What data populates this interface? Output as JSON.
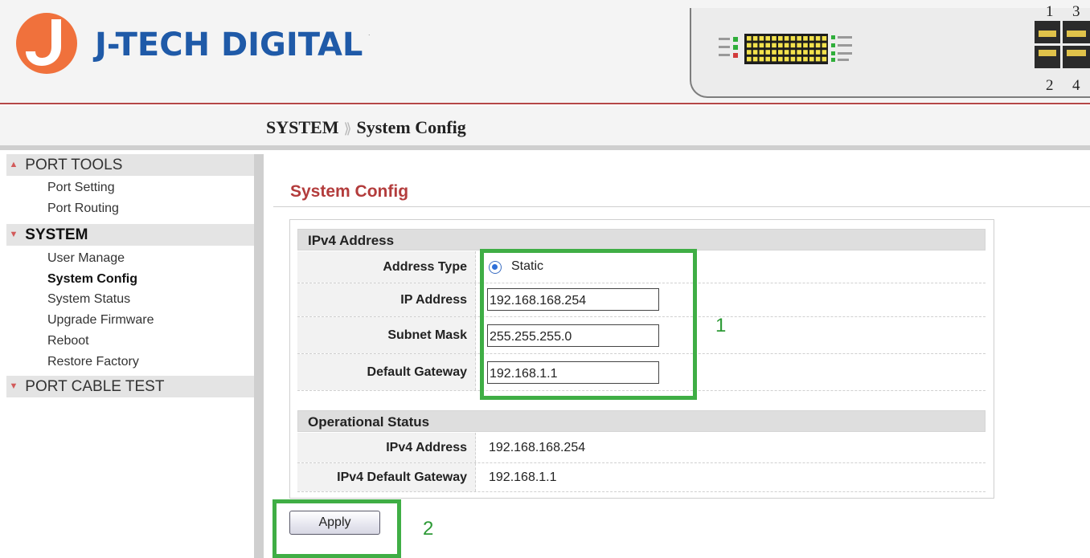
{
  "colors": {
    "brand_blue": "#1f5aa8",
    "brand_orange": "#f0713c",
    "accent_red": "#b33c3c",
    "annotation_green": "#3fae45",
    "radio_blue": "#2e6fd8"
  },
  "header": {
    "logo_text": "J-TECH DIGITAL",
    "logo_tm": ".",
    "port_numbers_top": [
      "1",
      "3"
    ],
    "port_numbers_bottom": [
      "2",
      "4"
    ]
  },
  "breadcrumb": {
    "section": "SYSTEM",
    "separator": "⟫",
    "page": "System Config"
  },
  "sidebar": {
    "groups": [
      {
        "label": "PORT TOOLS",
        "items": [
          "Port Setting",
          "Port Routing"
        ]
      },
      {
        "label": "SYSTEM",
        "items": [
          "User Manage",
          "System Config",
          "System Status",
          "Upgrade Firmware",
          "Reboot",
          "Restore Factory"
        ]
      },
      {
        "label": "PORT CABLE TEST",
        "items": []
      }
    ],
    "current_item": "System Config"
  },
  "main": {
    "title": "System Config",
    "ipv4": {
      "heading": "IPv4 Address",
      "address_type_label": "Address Type",
      "address_type_value": "Static",
      "ip_label": "IP Address",
      "ip_value": "192.168.168.254",
      "mask_label": "Subnet Mask",
      "mask_value": "255.255.255.0",
      "gateway_label": "Default Gateway",
      "gateway_value": "192.168.1.1"
    },
    "status": {
      "heading": "Operational Status",
      "ipv4_label": "IPv4 Address",
      "ipv4_value": "192.168.168.254",
      "gateway_label": "IPv4 Default Gateway",
      "gateway_value": "192.168.1.1"
    },
    "apply_label": "Apply"
  },
  "annotations": {
    "box1_number": "1",
    "box2_number": "2"
  }
}
